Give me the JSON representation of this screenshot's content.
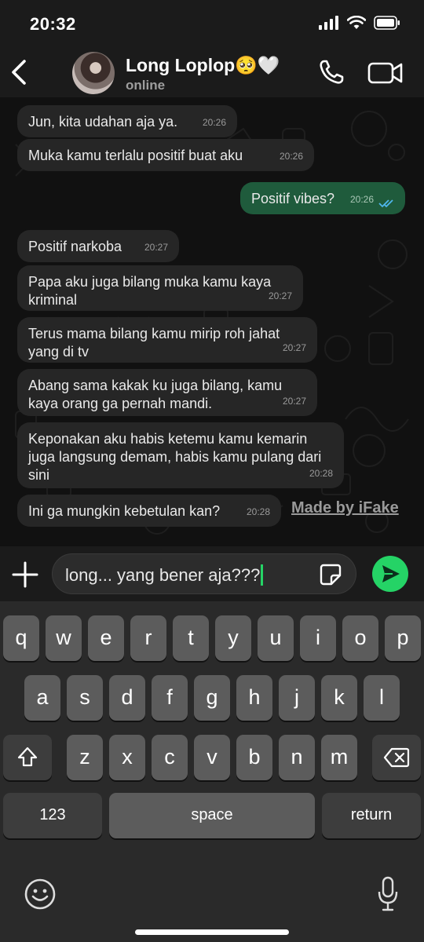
{
  "status_bar": {
    "time": "20:32"
  },
  "header": {
    "contact_name": "Long Loplop🥺🤍",
    "contact_status": "online",
    "icons": [
      "back-icon",
      "phone-icon",
      "video-camera-icon"
    ]
  },
  "messages": [
    {
      "direction": "in",
      "text": "Jun, kita udahan aja ya.",
      "time": "20:26"
    },
    {
      "direction": "in",
      "text": "Muka kamu terlalu positif buat aku",
      "time": "20:26"
    },
    {
      "direction": "out",
      "text": "Positif vibes?",
      "time": "20:26",
      "status": "read"
    },
    {
      "direction": "in",
      "text": "Positif narkoba",
      "time": "20:27"
    },
    {
      "direction": "in",
      "text": "Papa aku juga bilang muka kamu kaya kriminal",
      "time": "20:27"
    },
    {
      "direction": "in",
      "text": "Terus mama bilang kamu mirip roh jahat yang di tv",
      "time": "20:27"
    },
    {
      "direction": "in",
      "text": "Abang sama kakak ku juga bilang, kamu kaya orang ga pernah mandi.",
      "time": "20:27"
    },
    {
      "direction": "in",
      "text": "Keponakan aku habis ketemu kamu kemarin juga langsung demam, habis kamu pulang dari sini",
      "time": "20:28"
    },
    {
      "direction": "in",
      "text": "Ini ga mungkin kebetulan kan?",
      "time": "20:28"
    }
  ],
  "watermark": "Made by iFake",
  "composer": {
    "value": "long... yang bener aja???",
    "icons": [
      "plus-icon",
      "sticker-icon",
      "send-icon"
    ]
  },
  "keyboard": {
    "row1": [
      "q",
      "w",
      "e",
      "r",
      "t",
      "y",
      "u",
      "i",
      "o",
      "p"
    ],
    "row2": [
      "a",
      "s",
      "d",
      "f",
      "g",
      "h",
      "j",
      "k",
      "l"
    ],
    "row3": [
      "z",
      "x",
      "c",
      "v",
      "b",
      "n",
      "m"
    ],
    "numbers_label": "123",
    "space_label": "space",
    "return_label": "return",
    "icons": [
      "shift-icon",
      "backspace-icon",
      "emoji-icon",
      "microphone-icon"
    ]
  },
  "colors": {
    "outgoing_bubble": "#1f5b3c",
    "incoming_bubble": "#262626",
    "accent": "#25d366",
    "read_ticks": "#4fb6ec"
  }
}
